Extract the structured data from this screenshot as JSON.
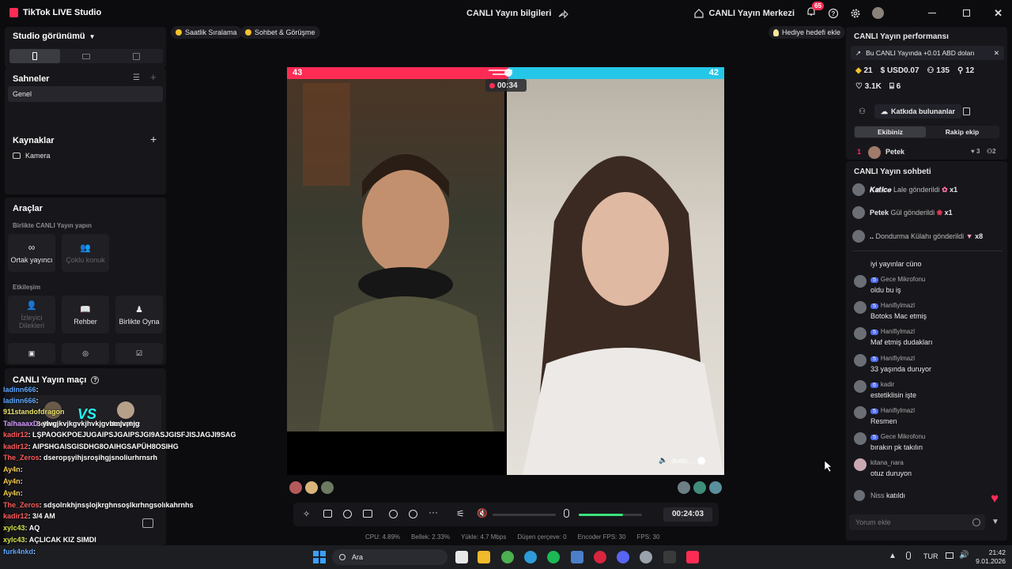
{
  "titlebar": {
    "app_name": "TikTok LIVE Studio",
    "center_title": "CANLI Yayın bilgileri",
    "live_center": "CANLI Yayın Merkezi",
    "notification_count": "65"
  },
  "left": {
    "studio_view": "Studio görünümü",
    "scenes_title": "Sahneler",
    "scene_general": "Genel",
    "sources_title": "Kaynaklar",
    "source_camera": "Kamera",
    "tools_title": "Araçlar",
    "collab_title": "Birlikte CANLI Yayın yapın",
    "tool_cohost": "Ortak yayıncı",
    "tool_multiguest": "Çoklu konuk",
    "interaction_title": "Etkileşim",
    "tool_viewer_wishes": "İzleyici Dilekleri",
    "tool_guide": "Rehber",
    "tool_play_together": "Birlikte Oyna",
    "match_title": "CANLI Yayın maçı",
    "match_left_name": "Selimyi",
    "match_vs": "VS",
    "match_right_name": "duduyimz"
  },
  "overlay_chat": [
    {
      "user": "ladinn666",
      "text": ":"
    },
    {
      "user": "ladinn666",
      "text": ":"
    },
    {
      "user": "911standofdragon",
      "text": ""
    },
    {
      "user": "TalhaaaxD",
      "text": ": ylvgjkvjkgvkjhvkjgvbmjvrnjg"
    },
    {
      "user": "kadir12",
      "text": ": LŞPAOGKPOEJUGAIPSJGAIPSJGI9ASJGISFJISJAGJI9SAG"
    },
    {
      "user": "kadir12",
      "text": ": AIPSHGAISGISDHG8OAIHGSAPÜH8OSIHG"
    },
    {
      "user": "The_Zeros",
      "text": ": dseropşyihjsroşihgjsnoliurhrnsrh"
    },
    {
      "user": "Ay4n",
      "text": ":"
    },
    {
      "user": "Ay4n",
      "text": ":"
    },
    {
      "user": "Ay4n",
      "text": ":"
    },
    {
      "user": "The_Zeros",
      "text": ": sdşolrıkhjnsşlojkrghnsoşlkırhngsolıkahrnhs"
    },
    {
      "user": "kadir12",
      "text": ": 3/4 AM"
    },
    {
      "user": "xylc43",
      "text": ": AQ"
    },
    {
      "user": "xylc43",
      "text": ": AÇLICAK KIZ SIMDI"
    },
    {
      "user": "furk4nkd",
      "text": ":"
    }
  ],
  "top_pills": {
    "hourly_rank": "Saatlik Sıralama",
    "chat_meet": "Sohbet & Görüşme",
    "gift_goal": "Hediye hedefi ekle"
  },
  "stage": {
    "score_left": "43",
    "score_right": "42",
    "timer": "00:34",
    "right_label": "dudu..."
  },
  "controls": {
    "elapsed": "00:24:03",
    "volume_level": 0.7
  },
  "stats": {
    "cpu": "CPU: 4.89%",
    "memory": "Bellek: 2.33%",
    "upload": "Yükle: 4.7 Mbps",
    "dropped": "Düşen çerçeve: 0",
    "encoder_fps": "Encoder FPS: 30",
    "fps": "FPS: 30"
  },
  "right": {
    "perf_title": "CANLI Yayın performansı",
    "earnings_banner": "Bu CANLI Yayında +0.01 ABD doları",
    "stat_diamonds": "21",
    "stat_usd": "USD0.07",
    "stat_viewers": "135",
    "stat_new": "12",
    "stat_likes": "3.1K",
    "stat_gifts": "6",
    "contributors_btn": "Katkıda bulunanlar",
    "tab_your_team": "Ekibiniz",
    "tab_rival": "Rakip ekip",
    "rank_num": "1",
    "rank_name": "Petek",
    "rank_hearts": "3",
    "rank_count": "2",
    "chat_title": "CANLI Yayın sohbeti",
    "gifts": [
      {
        "user": "𝑲𝒂𝒕𝒊𝒄𝒆",
        "text": "Lale gönderildi",
        "mult": "x1"
      },
      {
        "user": "Petek",
        "text": "Gül gönderildi",
        "mult": "x1"
      },
      {
        "user": "..",
        "text": "Dondurma Külahı gönderildi",
        "mult": "x8"
      }
    ],
    "messages": [
      {
        "lvl": "",
        "user": "",
        "text": "iyi yayınlar cüno"
      },
      {
        "lvl": "5",
        "user": "Gece Mikrofonu",
        "text": "oldu bu iş"
      },
      {
        "lvl": "5",
        "user": "Hanifiylmazl",
        "text": "Botoks Mac etmiş"
      },
      {
        "lvl": "5",
        "user": "Hanifiylmazl",
        "text": "Maf etmiş dudakları"
      },
      {
        "lvl": "5",
        "user": "Hanifiylmazl",
        "text": "33 yaşında duruyor"
      },
      {
        "lvl": "6",
        "user": "kadir",
        "text": "estetiklisin işte"
      },
      {
        "lvl": "5",
        "user": "Hanifiylmazl",
        "text": "Resmen"
      },
      {
        "lvl": "5",
        "user": "Gece Mikrofonu",
        "text": "bırakın pk takılın"
      },
      {
        "lvl": "",
        "user": "kitana_nara",
        "text": "otuz duruyon"
      }
    ],
    "joined_user": "Niss",
    "joined_text": "katıldı",
    "comment_placeholder": "Yorum ekle"
  },
  "taskbar": {
    "search": "Ara",
    "lang": "TUR",
    "time": "21:42",
    "date": "9.01.2026"
  },
  "colors": {
    "accent_pink": "#fe2c55",
    "accent_cyan": "#25f4ee",
    "level_blue": "#4f6cf5"
  }
}
